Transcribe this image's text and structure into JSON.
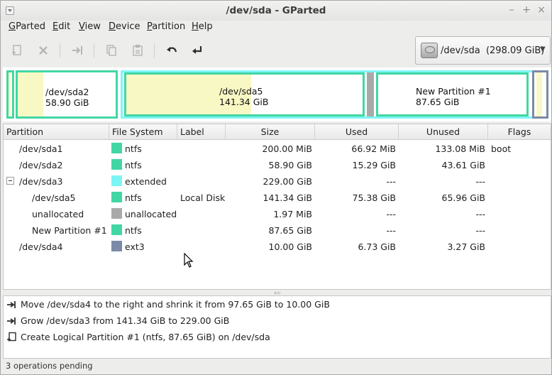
{
  "window": {
    "title": "/dev/sda - GParted"
  },
  "menubar": [
    {
      "label": "GParted",
      "ul": "G",
      "rest": "Parted"
    },
    {
      "label": "Edit",
      "ul": "E",
      "rest": "dit"
    },
    {
      "label": "View",
      "ul": "V",
      "rest": "iew"
    },
    {
      "label": "Device",
      "ul": "D",
      "rest": "evice"
    },
    {
      "label": "Partition",
      "ul": "P",
      "rest": "artition"
    },
    {
      "label": "Help",
      "ul": "H",
      "rest": "elp"
    }
  ],
  "toolbar": {
    "buttons": [
      {
        "name": "new-partition",
        "icon": "new-icon",
        "enabled": false
      },
      {
        "name": "delete-partition",
        "icon": "delete-icon",
        "enabled": false
      },
      {
        "name": "resize-move",
        "icon": "resize-move-icon",
        "enabled": false
      },
      {
        "name": "copy",
        "icon": "copy-icon",
        "enabled": false
      },
      {
        "name": "paste",
        "icon": "paste-icon",
        "enabled": false
      },
      {
        "name": "undo",
        "icon": "undo-icon",
        "enabled": true
      },
      {
        "name": "apply",
        "icon": "apply-icon",
        "enabled": true
      }
    ]
  },
  "device_selector": {
    "device": "/dev/sda",
    "size": "(298.09 GiB)"
  },
  "graph": {
    "partitions": [
      {
        "name": "",
        "size": ""
      },
      {
        "name": "/dev/sda2",
        "size": "58.90 GiB"
      },
      {
        "name": "/dev/sda5",
        "size": "141.34 GiB"
      },
      {
        "name": "",
        "size": ""
      },
      {
        "name": "New Partition #1",
        "size": "87.65 GiB"
      },
      {
        "name": "",
        "size": ""
      }
    ]
  },
  "table": {
    "columns": [
      "Partition",
      "File System",
      "Label",
      "Size",
      "Used",
      "Unused",
      "Flags"
    ],
    "rows": [
      {
        "partition": "/dev/sda1",
        "fs": "ntfs",
        "label": "",
        "size": "200.00 MiB",
        "used": "66.92 MiB",
        "unused": "133.08 MiB",
        "flags": "boot",
        "color": "#42d6a4",
        "indent": 0,
        "expander": false
      },
      {
        "partition": "/dev/sda2",
        "fs": "ntfs",
        "label": "",
        "size": "58.90 GiB",
        "used": "15.29 GiB",
        "unused": "43.61 GiB",
        "flags": "",
        "color": "#42d6a4",
        "indent": 0,
        "expander": false
      },
      {
        "partition": "/dev/sda3",
        "fs": "extended",
        "label": "",
        "size": "229.00 GiB",
        "used": "---",
        "unused": "---",
        "flags": "",
        "color": "#7df5f5",
        "indent": 0,
        "expander": true
      },
      {
        "partition": "/dev/sda5",
        "fs": "ntfs",
        "label": "Local Disk",
        "size": "141.34 GiB",
        "used": "75.38 GiB",
        "unused": "65.96 GiB",
        "flags": "",
        "color": "#42d6a4",
        "indent": 1,
        "expander": false
      },
      {
        "partition": "unallocated",
        "fs": "unallocated",
        "label": "",
        "size": "1.97 MiB",
        "used": "---",
        "unused": "---",
        "flags": "",
        "color": "#a9a9a9",
        "indent": 1,
        "expander": false
      },
      {
        "partition": "New Partition #1",
        "fs": "ntfs",
        "label": "",
        "size": "87.65 GiB",
        "used": "---",
        "unused": "---",
        "flags": "",
        "color": "#42d6a4",
        "indent": 1,
        "expander": false
      },
      {
        "partition": "/dev/sda4",
        "fs": "ext3",
        "label": "",
        "size": "10.00 GiB",
        "used": "6.73 GiB",
        "unused": "3.27 GiB",
        "flags": "",
        "color": "#7b8aa6",
        "indent": 0,
        "expander": false
      }
    ]
  },
  "operations": [
    {
      "icon": "resize-move-icon",
      "text": "Move /dev/sda4 to the right and shrink it from 97.65 GiB to 10.00 GiB"
    },
    {
      "icon": "resize-move-icon",
      "text": "Grow /dev/sda3 from 141.34 GiB to 229.00 GiB"
    },
    {
      "icon": "new-icon",
      "text": "Create Logical Partition #1 (ntfs, 87.65 GiB) on /dev/sda"
    }
  ],
  "status": {
    "text": "3 operations pending"
  },
  "colors": {
    "ntfs": "#42d6a4",
    "extended": "#7df5f5",
    "ext3": "#7b8aa6",
    "unallocated": "#a9a9a9",
    "used": "#f8f8c4"
  }
}
